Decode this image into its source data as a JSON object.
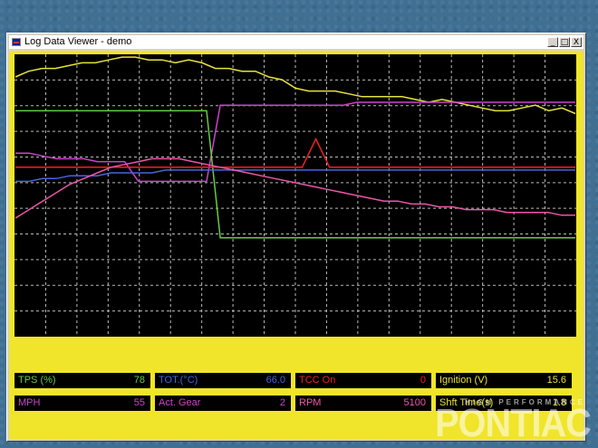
{
  "window": {
    "title": "Log Data Viewer - demo",
    "buttons": {
      "minimize": "_",
      "maximize": "□",
      "close": "X"
    }
  },
  "chart_data": {
    "type": "line",
    "grid": true,
    "background": "#000000",
    "frame_color": "#f0e52a",
    "series": [
      {
        "color": "#e8e23a",
        "values": [
          8,
          6,
          5,
          5,
          4,
          3,
          3,
          2,
          1,
          1,
          2,
          2,
          3,
          2,
          3,
          5,
          5,
          6,
          6,
          8,
          9,
          12,
          13,
          13,
          13,
          14,
          15,
          15,
          15,
          15,
          16,
          17,
          16,
          17,
          18,
          19,
          20,
          20,
          19,
          18,
          20,
          19,
          21
        ]
      },
      {
        "color": "#cc44cc",
        "values": [
          35,
          35,
          36,
          37,
          37,
          37,
          38,
          38,
          38,
          45,
          45,
          45,
          45,
          45,
          45,
          18,
          18,
          18,
          18,
          18,
          18,
          18,
          18,
          18,
          18,
          17,
          17,
          17,
          17,
          17,
          17,
          17,
          17,
          17,
          17,
          17,
          17,
          17,
          17,
          17,
          17,
          17
        ]
      },
      {
        "color": "#66cc44",
        "values": [
          20,
          20,
          20,
          20,
          20,
          20,
          20,
          20,
          20,
          20,
          20,
          20,
          20,
          20,
          20,
          65,
          65,
          65,
          65,
          65,
          65,
          65,
          65,
          65,
          65,
          65,
          65,
          65,
          65,
          65,
          65,
          65,
          65,
          65,
          65,
          65,
          65,
          65,
          65,
          65,
          65,
          65
        ]
      },
      {
        "color": "#ee2222",
        "values": [
          40,
          40,
          40,
          40,
          40,
          40,
          40,
          40,
          40,
          40,
          40,
          40,
          40,
          40,
          40,
          40,
          40,
          40,
          40,
          40,
          40,
          40,
          30,
          40,
          40,
          40,
          40,
          40,
          40,
          40,
          40,
          40,
          40,
          40,
          40,
          40,
          40,
          40,
          40,
          40,
          40,
          40
        ]
      },
      {
        "color": "#4466dd",
        "values": [
          45,
          45,
          44,
          44,
          43,
          43,
          43,
          42,
          42,
          42,
          42,
          41,
          41,
          41,
          41,
          41,
          41,
          41,
          41,
          41,
          41,
          41,
          41,
          41,
          41,
          41,
          41,
          41,
          41,
          41,
          41,
          41,
          41,
          41,
          41,
          41,
          41,
          41,
          41,
          41,
          41,
          41
        ]
      },
      {
        "color": "#ee55aa",
        "values": [
          58,
          55,
          52,
          49,
          46,
          44,
          42,
          40,
          39,
          38,
          37,
          37,
          37,
          38,
          39,
          40,
          41,
          42,
          43,
          44,
          45,
          46,
          47,
          48,
          49,
          50,
          51,
          52,
          52,
          53,
          53,
          54,
          54,
          55,
          55,
          55,
          56,
          56,
          56,
          56,
          57,
          57
        ]
      }
    ]
  },
  "readouts": [
    {
      "label": "TPS (%)",
      "value": "78",
      "color": "#66cc44"
    },
    {
      "label": "TOT.(°C)",
      "value": "66.0",
      "color": "#4466dd"
    },
    {
      "label": "TCC On",
      "value": "0",
      "color": "#ee2222"
    },
    {
      "label": "Ignition (V)",
      "value": "15.6",
      "color": "#e8e23a"
    },
    {
      "label": "MPH",
      "value": "55",
      "color": "#cc44cc"
    },
    {
      "label": "Act. Gear",
      "value": "2",
      "color": "#cc44cc"
    },
    {
      "label": "RPM",
      "value": "5100",
      "color": "#ee55aa"
    },
    {
      "label": "Shft Time(s)",
      "value": "1.8",
      "color": "#e8e23a"
    }
  ],
  "watermark": {
    "brand": "PONTIAC",
    "tagline": "HIGH PERFORMANCE"
  }
}
